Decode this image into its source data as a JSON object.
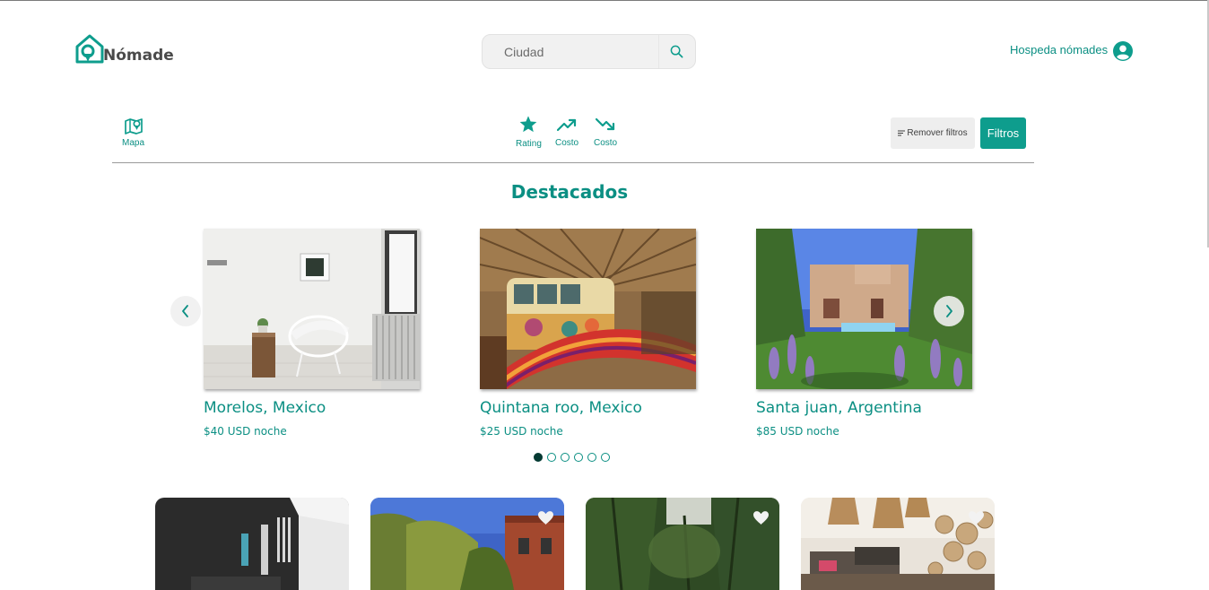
{
  "header": {
    "logo_text": "Nómade",
    "search": {
      "placeholder": "Ciudad"
    },
    "host_link": "Hospeda nómades"
  },
  "filters": {
    "map_label": "Mapa",
    "rating_label": "Rating",
    "cost_up_label": "Costo",
    "cost_down_label": "Costo",
    "remove_label": "Remover filtros",
    "filter_button": "Filtros"
  },
  "featured": {
    "title": "Destacados",
    "cards": [
      {
        "title": "Morelos, Mexico",
        "price": "$40 USD noche"
      },
      {
        "title": "Quintana roo, Mexico",
        "price": "$25 USD noche"
      },
      {
        "title": "Santa juan, Argentina",
        "price": "$85 USD noche"
      }
    ],
    "dots_count": 6,
    "active_dot": 1
  },
  "colors": {
    "brand": "#0b8f83",
    "button": "#0e9d8d",
    "remove_button_bg": "#eeeeee"
  }
}
